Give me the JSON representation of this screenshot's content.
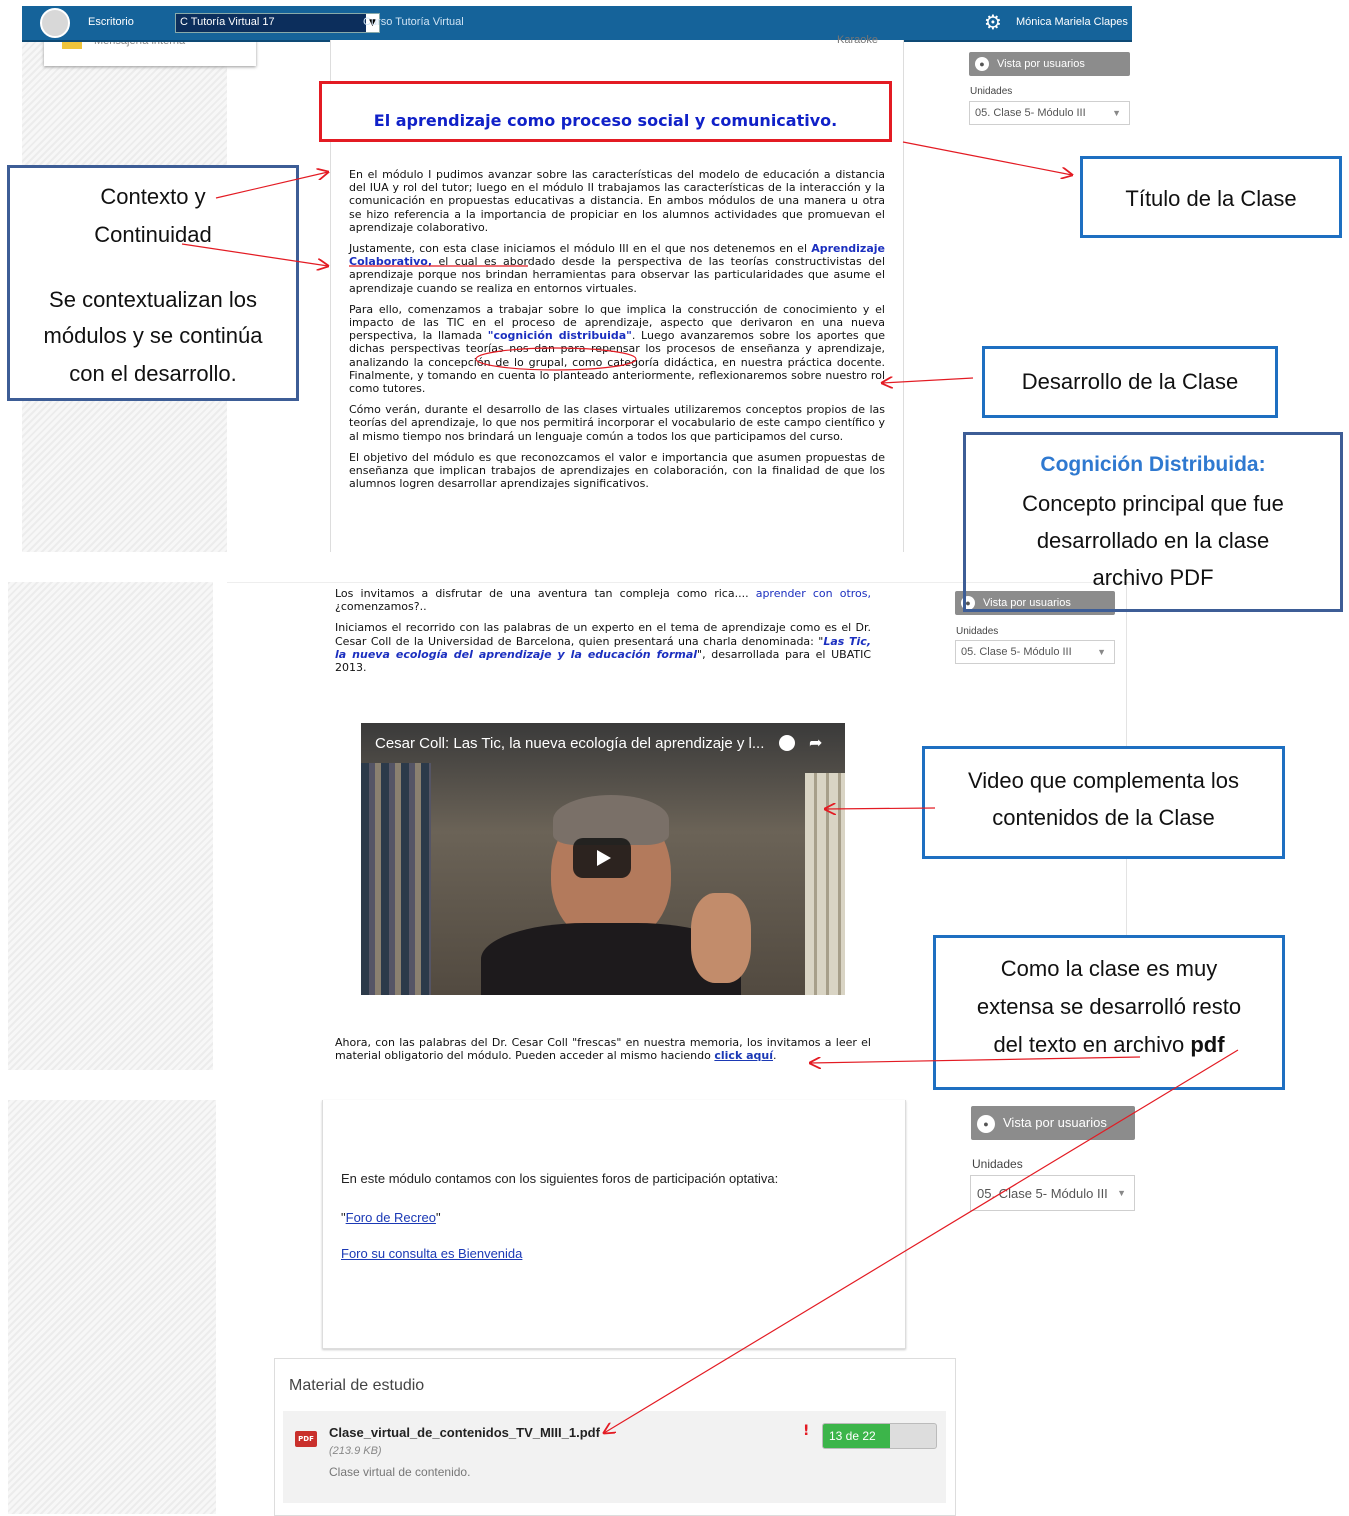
{
  "topbar": {
    "escritorio": "Escritorio",
    "course": "C Tutoría Virtual 17",
    "breadcrumb": "Curso Tutoría Virtual",
    "user": "Mónica Mariela Clapes",
    "colors": {
      "bar": "#15639a"
    }
  },
  "sidebar_tab": {
    "label": "Mensajería interna"
  },
  "header_cut": {
    "text": "Karaoke"
  },
  "lesson": {
    "title": "El aprendizaje como proceso social y comunicativo.",
    "p1": "En el módulo I pudimos avanzar sobre las características del modelo de educación a distancia del IUA y rol del tutor; luego en el módulo II trabajamos las características de la interacción y la comunicación en propuestas educativas a distancia. En ambos módulos de una manera u otra se hizo referencia a la importancia de propiciar en los alumnos actividades que promuevan el aprendizaje colaborativo.",
    "p2a": "Justamente, con esta clase iniciamos el módulo III en el que nos detenemos en el ",
    "p2b": "Aprendizaje Colaborativo,",
    "p2c": " el cual es abordado desde la perspectiva de las teorías constructivistas del aprendizaje porque nos brindan herramientas para observar las particularidades que asume el aprendizaje cuando se realiza en entornos virtuales.",
    "p3a": "Para ello, comenzamos a trabajar sobre lo que implica la construcción de conocimiento y el impacto de las TIC en el proceso de aprendizaje, aspecto que derivaron en una nueva perspectiva, la llamada ",
    "p3b": "\"cognición distribuida\"",
    "p3c": ". Luego avanzaremos sobre los aportes que dichas perspectivas teorías nos dan para repensar los procesos de enseñanza y aprendizaje, analizando la concepción de lo grupal, como categoría didáctica, en nuestra práctica docente. Finalmente, y tomando en cuenta lo planteado anteriormente, reflexionaremos sobre nuestro rol como tutores.",
    "p4": "Cómo verán, durante el desarrollo de las clases virtuales utilizaremos conceptos propios de las teorías del aprendizaje, lo que nos permitirá incorporar el vocabulario de este campo científico y al mismo tiempo nos brindará un lenguaje común a todos los que participamos del curso.",
    "p5": "El objetivo del módulo es que reconozcamos el valor e importancia que asumen propuestas de enseñanza que implican trabajos de aprendizajes en colaboración, con la finalidad de que los alumnos logren desarrollar aprendizajes significativos."
  },
  "section2": {
    "p1a": "Los invitamos a disfrutar de una aventura tan compleja como rica.... ",
    "p1b": "aprender con otros,",
    "p1c": " ¿comenzamos?..",
    "p2a": "Iniciamos el recorrido con las palabras de un experto en el tema de aprendizaje como es el Dr. Cesar Coll de la Universidad de Barcelona, quien presentará una charla denominada: \"",
    "p2b": "Las Tic, la nueva ecología del aprendizaje y la educación formal",
    "p2c": "\", desarrollada para el UBATIC 2013.",
    "video_title": "Cesar Coll: Las Tic, la nueva ecología del aprendizaje y l...",
    "p3a": "Ahora, con las palabras del Dr. Cesar Coll \"frescas\" en nuestra memoria, los invitamos a leer el material obligatorio del módulo. Pueden acceder al mismo haciendo ",
    "p3b": "click aquí",
    "p3c": "."
  },
  "section3": {
    "foros_intro": "En este módulo contamos con los siguientes foros de participación optativa:",
    "foro1_quote_open": "\"",
    "foro1": "Foro de Recreo",
    "foro1_quote_close": "\"",
    "foro2": "Foro su consulta es Bienvenida"
  },
  "right_panel": {
    "vista": "Vista por usuarios",
    "unidades": "Unidades",
    "unidad_sel": "05. Clase 5- Módulo III"
  },
  "material": {
    "title": "Material de estudio",
    "pdf_name": "Clase_virtual_de_contenidos_TV_MIII_1.pdf",
    "pdf_size": "(213.9 KB)",
    "pdf_desc": "Clase virtual de contenido.",
    "pdf_icon_label": "PDF",
    "alert": "!",
    "progress_text": "13 de 22",
    "progress_value": 0.59
  },
  "callouts": {
    "contexto_title": "Contexto y Continuidad",
    "contexto_line1": "Contexto y",
    "contexto_line2": "Continuidad",
    "contexto_body1": "Se contextualizan los",
    "contexto_body2": "módulos y se continúa",
    "contexto_body3": "con el desarrollo.",
    "titulo": "Título de la Clase",
    "desarrollo": "Desarrollo de la Clase",
    "cognicion_title": "Cognición Distribuida:",
    "cognicion_body1": "Concepto principal que fue",
    "cognicion_body2": "desarrollado en la clase",
    "cognicion_body3": "archivo  PDF",
    "video1": "Video que complementa los",
    "video2": "contenidos de la Clase",
    "pdf1": "Como la clase es muy",
    "pdf2": "extensa se desarrolló resto",
    "pdf3a": "del texto en archivo ",
    "pdf3b": "pdf"
  }
}
